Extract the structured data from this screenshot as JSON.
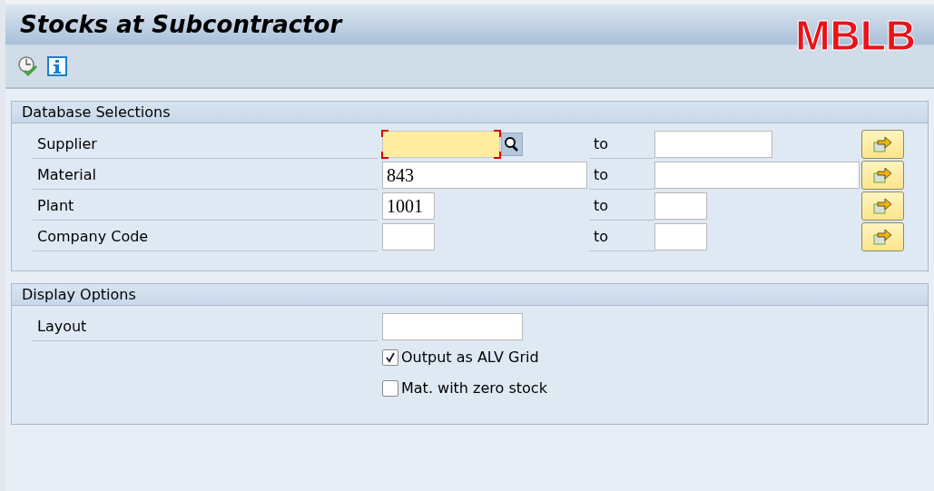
{
  "window": {
    "title": "Stocks at Subcontractor"
  },
  "annotation": "MBLB",
  "toolbar": {
    "buttons": [
      {
        "kind": "execute"
      },
      {
        "kind": "info"
      }
    ]
  },
  "sections": [
    {
      "title": "Database Selections",
      "kind": "ranges",
      "rows": [
        {
          "label": "Supplier",
          "focused": true,
          "to": "to"
        },
        {
          "label": "Material",
          "low": "843",
          "focused": false,
          "to": "to"
        },
        {
          "label": "Plant",
          "low": "1001",
          "focused": false,
          "to": "to"
        },
        {
          "label": "Company Code",
          "focused": false,
          "to": "to"
        }
      ]
    },
    {
      "title": "Display Options",
      "kind": "options",
      "layout": {
        "label": "Layout"
      },
      "checkboxes": [
        {
          "label": "Output as ALV Grid",
          "checked": true
        },
        {
          "label": "Mat. with zero stock",
          "checked": false
        }
      ]
    }
  ]
}
